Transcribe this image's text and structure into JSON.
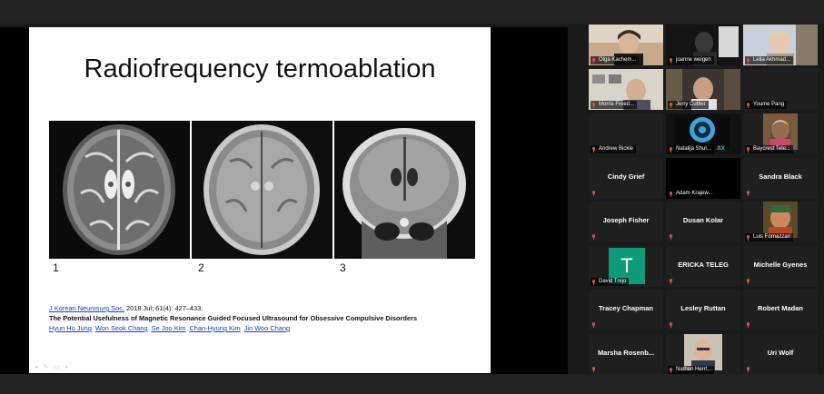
{
  "slide": {
    "title": "Radiofrequency termoablation",
    "image_numbers": [
      "1",
      "2",
      "3"
    ],
    "citation": {
      "journal_link": "J Korean Neurosurg Soc.",
      "journal_rest": " 2018 Jul; 61(4): 427–433.",
      "article_title": "The Potential Usefulness of Magnetic Resonance Guided Focused Ultrasound for Obsessive Compulsive Disorders",
      "authors": [
        "Hyun Ho Jung",
        "Won Seok Chang",
        "Se Joo Kim",
        "Chan-Hyung Kim",
        "Jin Woo Chang"
      ]
    }
  },
  "participants": [
    {
      "name": "Olga Kachem...",
      "label": "Olga Kachem...",
      "video": true,
      "active": true
    },
    {
      "name": "joanne weigen",
      "label": "joanne weigen",
      "video": true
    },
    {
      "name": "Leila Akhmad...",
      "label": "Leila Akhmad...",
      "video": true
    },
    {
      "name": "Morris Freed...",
      "label": "Morris Freed...",
      "video": true
    },
    {
      "name": "Jerry Cuttler",
      "label": "Jerry Cuttler",
      "video": true
    },
    {
      "name": "Youme Pang",
      "label": "Youme Pang",
      "video": false
    },
    {
      "name": "Andrew Bickle",
      "label": "Andrew Bickle",
      "video": false
    },
    {
      "name": "Natalija Shul...",
      "label": "Natalija Shul...",
      "video": true
    },
    {
      "name": "Baycrest Tele...",
      "label": "Baycrest Tele...",
      "video": true
    },
    {
      "name": "Cindy Grief",
      "video": false
    },
    {
      "name": "Adam Krajew...",
      "label": "Adam Krajew...",
      "video": false
    },
    {
      "name": "Sandra Black",
      "video": false
    },
    {
      "name": "Joseph Fisher",
      "video": false
    },
    {
      "name": "Dusan Kolar",
      "video": false
    },
    {
      "name": "Luis Fornazzari",
      "label": "Luis Fornazzari",
      "video": true
    },
    {
      "name": "David Trejo",
      "label": "David Trejo",
      "video": false,
      "avatar_letter": "T"
    },
    {
      "name": "ERICKA TELEG",
      "video": false
    },
    {
      "name": "Michelle Gyenes",
      "video": false
    },
    {
      "name": "Tracey Chapman",
      "video": false
    },
    {
      "name": "Lesley Ruttan",
      "video": false
    },
    {
      "name": "Robert Madan",
      "video": false
    },
    {
      "name": "Marsha Rosenb...",
      "video": false
    },
    {
      "name": "Nathan Herrl...",
      "label": "Nathan Herrl...",
      "video": true
    },
    {
      "name": "Uri Wolf",
      "video": false
    }
  ],
  "colors": {
    "active_border": "#d9c83a",
    "muted_mic": "#e04b4b",
    "link": "#1a3fc4",
    "avatar_teal": "#0f9a7c"
  }
}
